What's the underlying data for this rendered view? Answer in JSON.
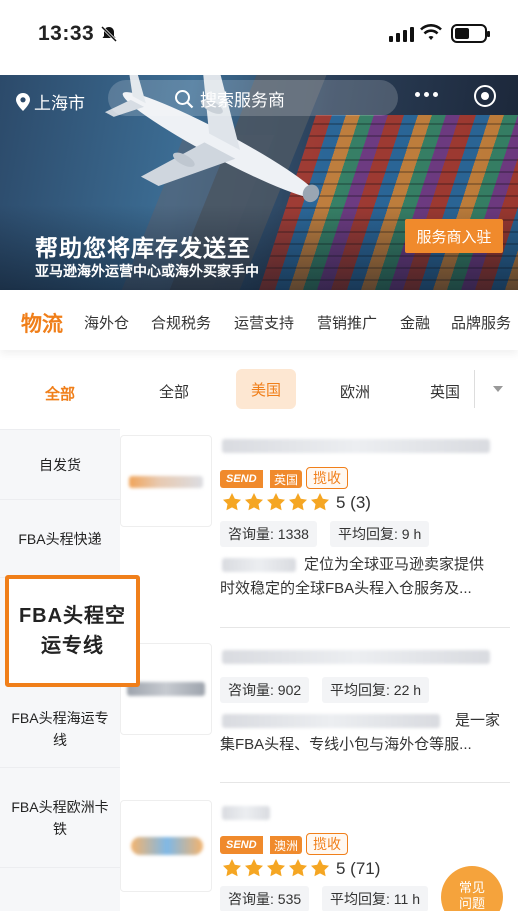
{
  "status_bar": {
    "time": "13:33"
  },
  "header": {
    "location": "上海市",
    "search_placeholder": "搜索服务商"
  },
  "banner": {
    "headline": "帮助您将库存发送至",
    "subline": "亚马逊海外运营中心或海外买家手中",
    "join_button": "服务商入驻"
  },
  "categories": [
    {
      "label": "物流",
      "active": true
    },
    {
      "label": "海外仓"
    },
    {
      "label": "合规税务"
    },
    {
      "label": "运营支持"
    },
    {
      "label": "营销推广"
    },
    {
      "label": "金融"
    },
    {
      "label": "品牌服务"
    }
  ],
  "sidebar": [
    {
      "label": "全部",
      "active": true
    },
    {
      "label": "自发货"
    },
    {
      "label": "FBA头程快递"
    },
    {
      "label": "FBA头程空运专线",
      "highlighted": true
    },
    {
      "label": "FBA头程海运专线"
    },
    {
      "label": "FBA头程欧洲卡铁"
    }
  ],
  "regions": [
    "全部",
    "美国",
    "欧洲",
    "英国"
  ],
  "selected_region": "美国",
  "listings": [
    {
      "send_badge": "SEND",
      "country": "英国",
      "pickup": "揽收",
      "rating": "5 (3)",
      "inquiries": "咨询量: 1338",
      "avg_reply": "平均回复: 9 h",
      "desc_line1": "定位为全球亚马逊卖家提供",
      "desc_line2": "时效稳定的全球FBA头程入仓服务及..."
    },
    {
      "inquiries": "咨询量: 902",
      "avg_reply": "平均回复: 22 h",
      "desc_line1": "是一家",
      "desc_line2": "集FBA头程、专线小包与海外仓等服..."
    },
    {
      "send_badge": "SEND",
      "country": "澳洲",
      "pickup": "揽收",
      "rating": "5 (71)",
      "inquiries": "咨询量: 535",
      "avg_reply": "平均回复: 11 h"
    }
  ],
  "faq_button": "常见问题",
  "colors": {
    "accent": "#f07f1a",
    "banner_button": "#f08a2c",
    "star": "#f5a623"
  }
}
